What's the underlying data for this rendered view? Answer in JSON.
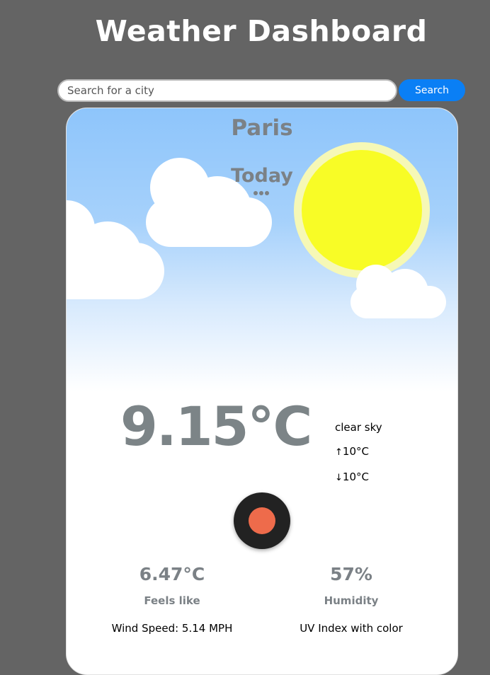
{
  "app": {
    "title": "Weather Dashboard"
  },
  "search": {
    "placeholder": "Search for a city",
    "value": "",
    "button_label": "Search",
    "button_color": "#0a7ff5"
  },
  "card": {
    "city": "Paris",
    "day_label": "Today",
    "scene_icons": [
      "sun-icon",
      "cloud-icon",
      "cloud-icon",
      "cloud-icon"
    ],
    "temperature": "9.15°C",
    "description": "clear sky",
    "max_arrow": "↑",
    "max_temp": "10°C",
    "min_arrow": "↓",
    "min_temp": "10°C",
    "record_button_color": "#ee6b4b",
    "feels_like_value": "6.47°C",
    "feels_like_label": "Feels like",
    "humidity_value": "57%",
    "humidity_label": "Humidity",
    "wind_speed": "Wind Speed: 5.14 MPH",
    "uv_index": "UV Index with color"
  },
  "colors": {
    "background": "#646464",
    "text_muted": "#7b8186",
    "sun": "#f8fc26",
    "sky": "#8ec5fb"
  }
}
